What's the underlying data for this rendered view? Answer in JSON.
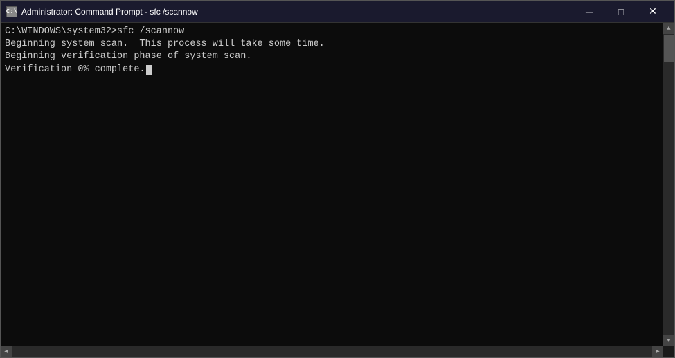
{
  "titleBar": {
    "icon": "C:",
    "title": "Administrator: Command Prompt - sfc /scannow",
    "minimizeLabel": "─",
    "maximizeLabel": "□",
    "closeLabel": "✕"
  },
  "console": {
    "lines": [
      "C:\\WINDOWS\\system32>sfc /scannow",
      "",
      "Beginning system scan.  This process will take some time.",
      "",
      "Beginning verification phase of system scan.",
      "Verification 0% complete."
    ]
  }
}
